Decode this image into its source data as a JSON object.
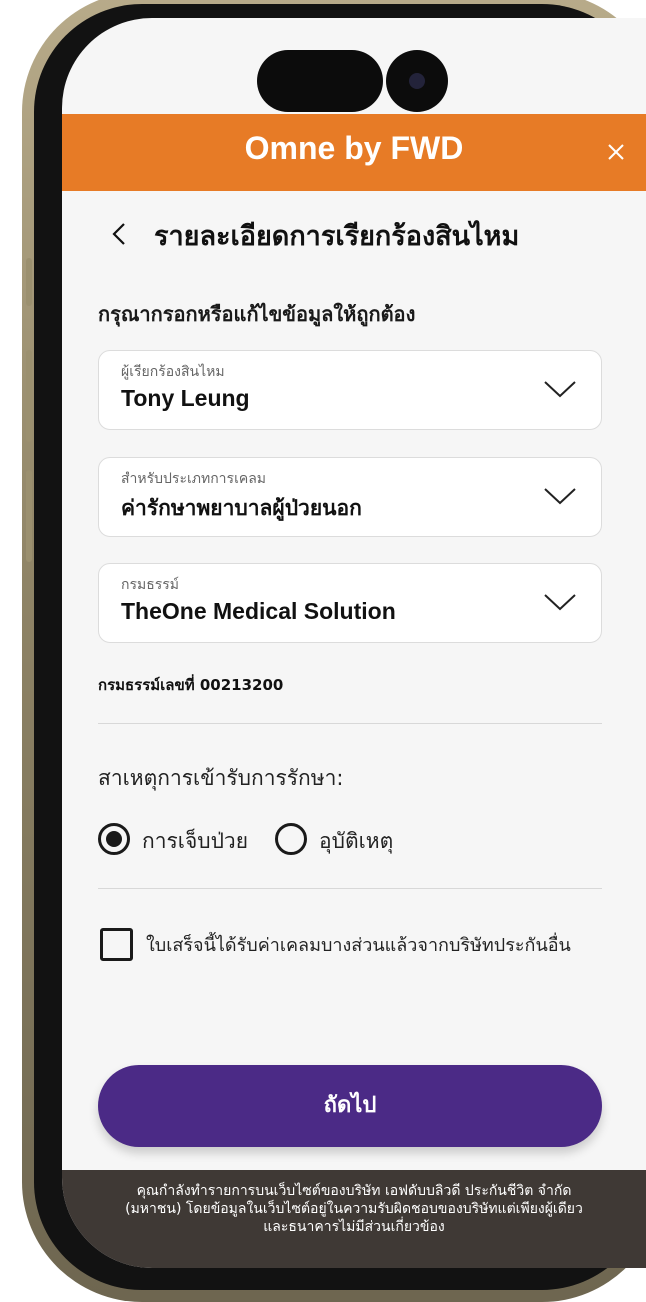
{
  "header": {
    "title": "Omne by FWD",
    "close_icon": "close-icon",
    "background_color": "#e77b26"
  },
  "page": {
    "title": "รายละเอียดการเรียกร้องสินไหม",
    "instruction": "กรุณากรอกหรือแก้ไขข้อมูลให้ถูกต้อง"
  },
  "fields": {
    "claimant": {
      "label": "ผู้เรียกร้องสินไหม",
      "value": "Tony Leung"
    },
    "claim_type": {
      "label": "สำหรับประเภทการเคลม",
      "value": "ค่ารักษาพยาบาลผู้ป่วยนอก"
    },
    "policy": {
      "label": "กรมธรรม์",
      "value": "TheOne Medical Solution"
    }
  },
  "policy_number_line": "กรมธรรม์เลขที่ 00213200",
  "treatment": {
    "label": "สาเหตุการเข้ารับการรักษา:",
    "options": [
      {
        "label": "การเจ็บป่วย",
        "selected": true
      },
      {
        "label": "อุบัติเหตุ",
        "selected": false
      }
    ]
  },
  "other_claim_checkbox": {
    "label": "ใบเสร็จนี้ได้รับค่าเคลมบางส่วนแล้วจากบริษัทประกันอื่น",
    "checked": false
  },
  "next_button": {
    "label": "ถัดไป",
    "color": "#4b2a86"
  },
  "disclaimer": {
    "line1": "คุณกำลังทำรายการบนเว็บไซต์ของบริษัท เอฟดับบลิวดี ประกันชีวิต จำกัด",
    "line2": "(มหาชน) โดยข้อมูลในเว็บไซต์อยู่ในความรับผิดชอบของบริษัทแต่เพียงผู้เดียว",
    "line3": "และธนาคารไม่มีส่วนเกี่ยวข้อง"
  }
}
